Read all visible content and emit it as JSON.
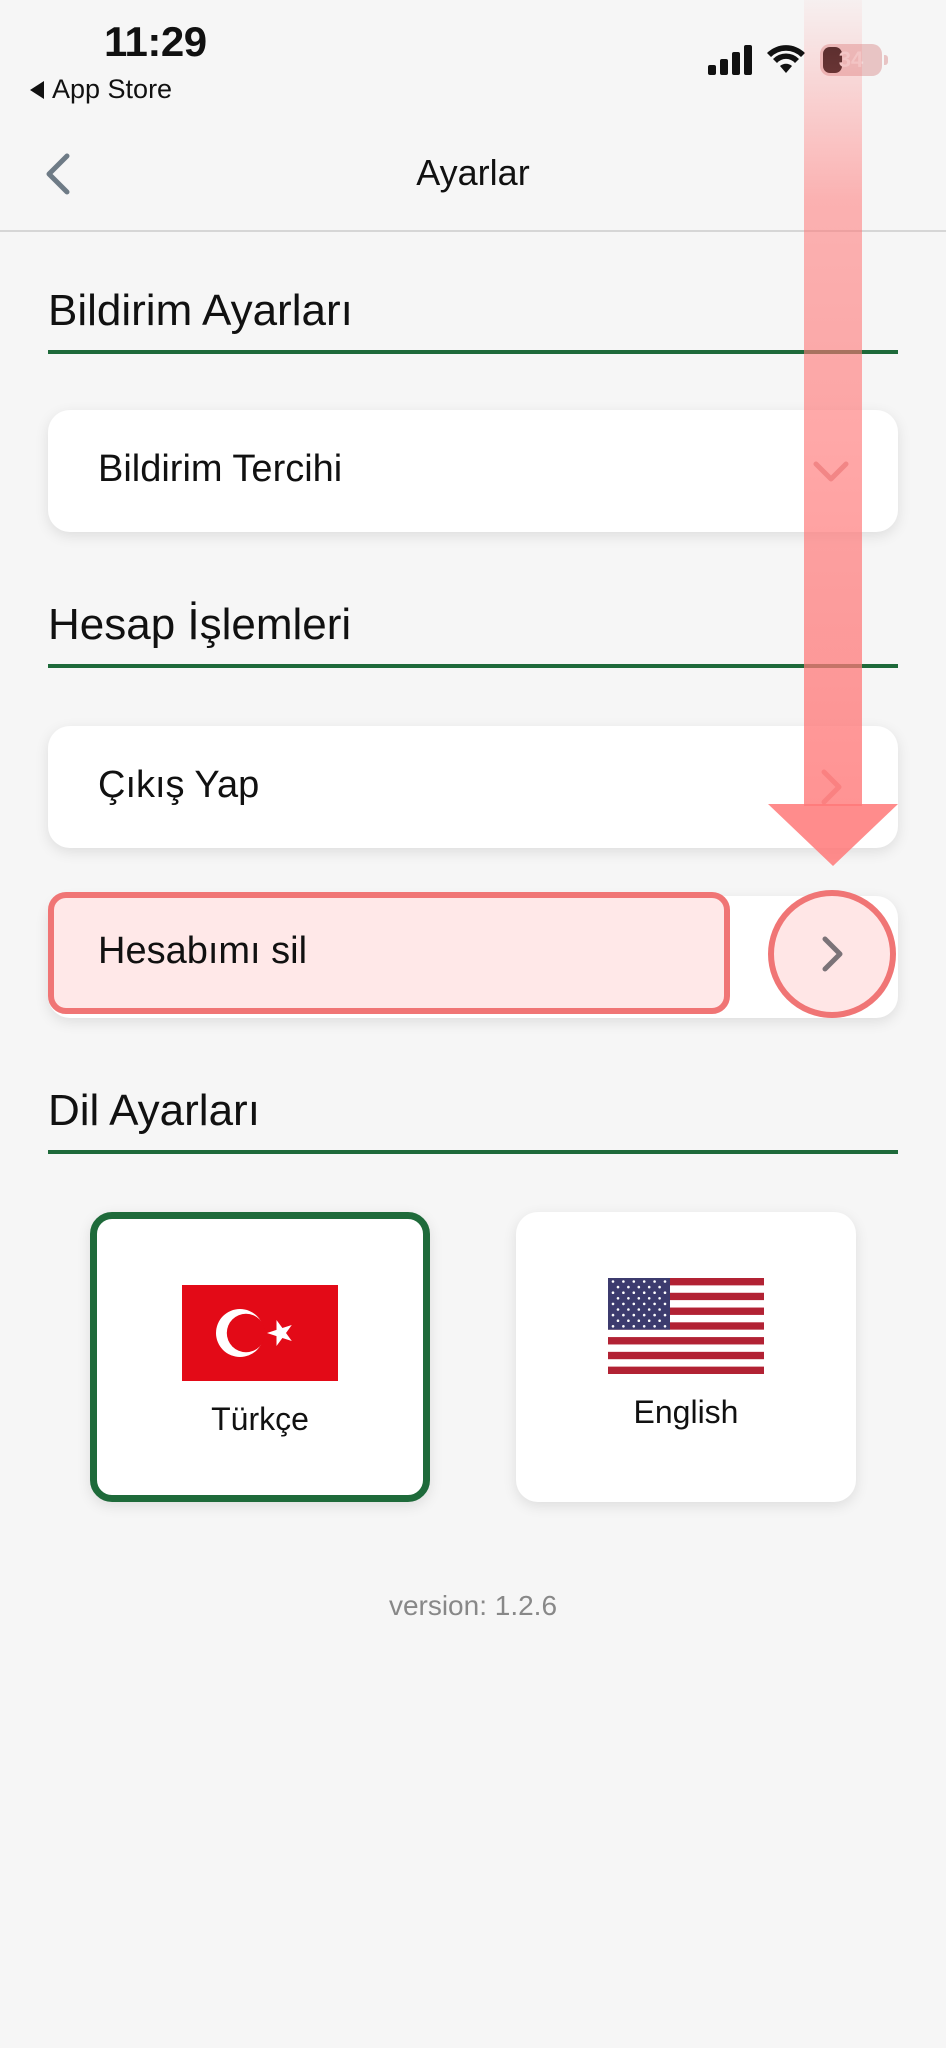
{
  "status_bar": {
    "time": "11:29",
    "back_app": "App Store",
    "battery": "34",
    "battery_level": 0.34
  },
  "nav": {
    "title": "Ayarlar",
    "back_icon": "chevron-left-icon"
  },
  "sections": {
    "notifications": {
      "title": "Bildirim Ayarları",
      "preference_label": "Bildirim Tercihi"
    },
    "account": {
      "title": "Hesap İşlemleri",
      "logout_label": "Çıkış Yap",
      "delete_label": "Hesabımı sil"
    },
    "language": {
      "title": "Dil Ayarları",
      "options": [
        {
          "label": "Türkçe",
          "flag": "turkey-flag",
          "selected": true
        },
        {
          "label": "English",
          "flag": "usa-flag",
          "selected": false
        }
      ]
    }
  },
  "footer": {
    "version": "version: 1.2.6"
  },
  "colors": {
    "accent": "#1e6a3a",
    "highlight": "#f07575",
    "background": "#f6f6f6",
    "chevron": "#8a8a96"
  }
}
